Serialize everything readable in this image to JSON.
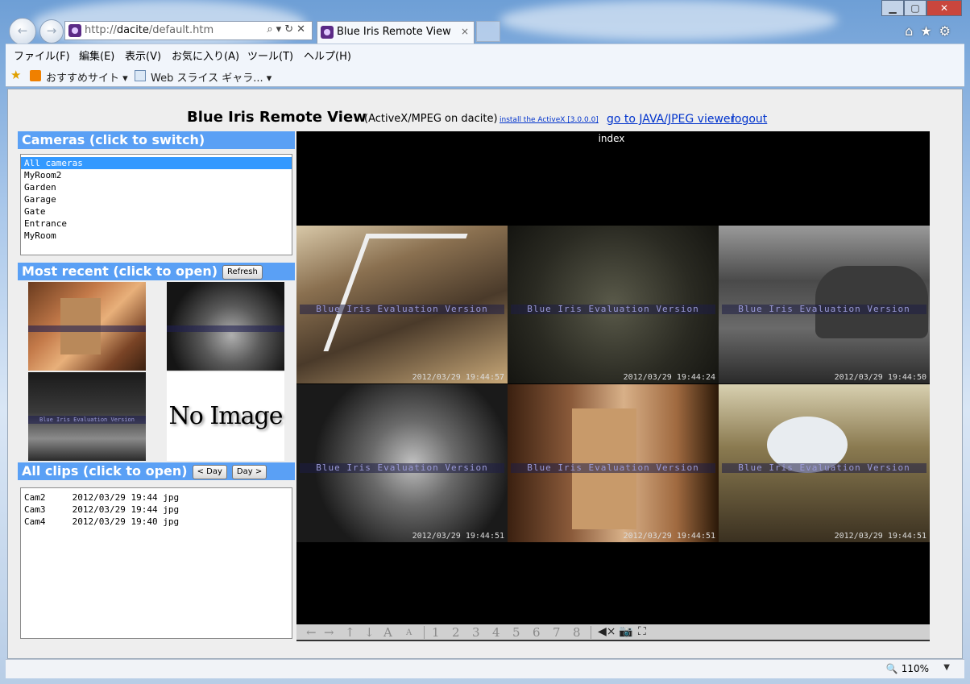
{
  "browser": {
    "back_icon": "back-arrow-icon",
    "forward_icon": "forward-arrow-icon",
    "address_prefix": "http://",
    "address_host": "dacite",
    "address_path": "/default.htm",
    "tab_title": "Blue Iris Remote View",
    "tab_close": "×",
    "zoom": "110%",
    "right_icons": [
      "home-icon",
      "star-icon",
      "gear-icon"
    ]
  },
  "menu": {
    "items": [
      "ファイル(F)",
      "編集(E)",
      "表示(V)",
      "お気に入り(A)",
      "ツール(T)",
      "ヘルプ(H)"
    ]
  },
  "favorites": {
    "suggested": "おすすめサイト ▾",
    "slices": "Web スライス ギャラ... ▾"
  },
  "page": {
    "title": "Blue Iris Remote View",
    "subtitle": "(ActiveX/MPEG on dacite)",
    "install_link": "install the ActiveX [3.0.0.0]",
    "java_link": "go to JAVA/JPEG viewer",
    "logout_link": "logout"
  },
  "cameras": {
    "header": "Cameras (click to switch)",
    "items": [
      "All cameras",
      "MyRoom2",
      "Garden",
      "Garage",
      "Gate",
      "Entrance",
      "MyRoom"
    ],
    "selected": 0
  },
  "recent": {
    "header": "Most recent (click to open)",
    "refresh_label": "Refresh",
    "no_image": "No Image",
    "thumb_caption": "Blue Iris Evaluation Version"
  },
  "clips": {
    "header": "All clips (click to open)",
    "prev_day": "< Day",
    "next_day": "Day >",
    "rows": [
      {
        "cam": "Cam2",
        "date": "2012/03/29 19:44",
        "type": "jpg"
      },
      {
        "cam": "Cam3",
        "date": "2012/03/29 19:44",
        "type": "jpg"
      },
      {
        "cam": "Cam4",
        "date": "2012/03/29 19:40",
        "type": "jpg"
      }
    ]
  },
  "viewer": {
    "label": "index",
    "eval_text": "Blue Iris Evaluation Version",
    "timestamps": [
      "2012/03/29 19:44:57",
      "2012/03/29 19:44:24",
      "2012/03/29 19:44:50",
      "2012/03/29 19:44:51",
      "2012/03/29 19:44:51",
      "2012/03/29 19:44:51"
    ],
    "controls": [
      "←",
      "→",
      "↑",
      "↓",
      "A",
      "A",
      "1",
      "2",
      "3",
      "4",
      "5",
      "6",
      "7",
      "8"
    ]
  }
}
